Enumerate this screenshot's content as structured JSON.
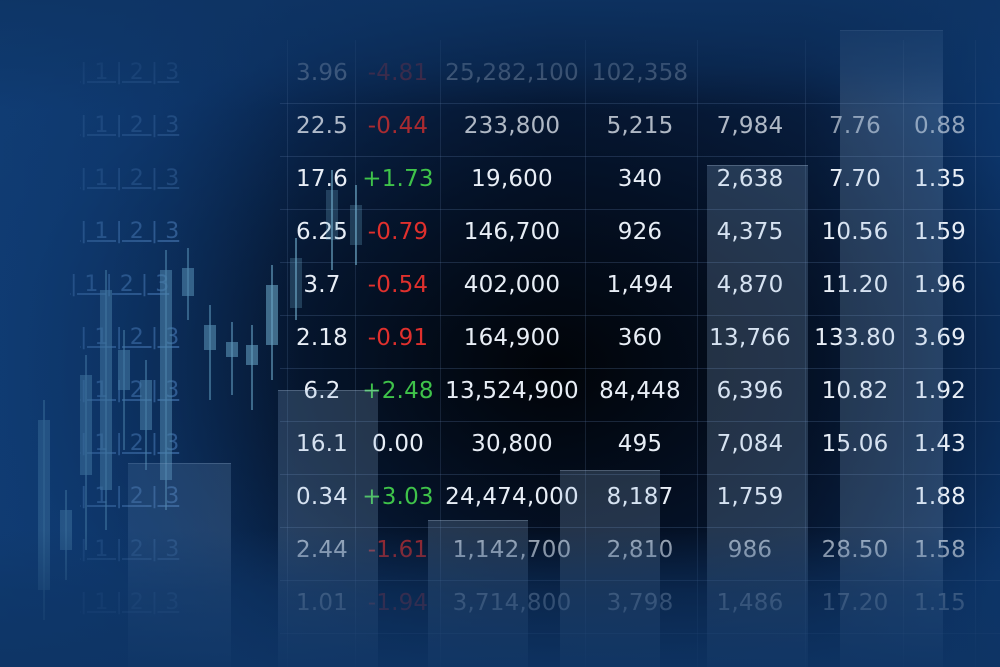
{
  "side_labels": [
    "| 1 | 2 | 3",
    "| 1 | 2 | 3",
    "| 1 | 2 | 3",
    "| 1 | 2 | 3",
    "| 1 | 2 | 3",
    "| 1 | 2 | 3",
    "| 1 | 2 | 3",
    "| 1 | 2 | 3",
    "| 1 | 2 | 3",
    "| 1 | 2 | 3",
    "| 1 | 2 | 3"
  ],
  "rows": [
    {
      "c1": "3.96",
      "c2": "-4.81",
      "c2_sign": "neg",
      "c3": "25,282,100",
      "c4": "102,358",
      "c5": "",
      "c6": "",
      "c7": ""
    },
    {
      "c1": "22.5",
      "c2": "-0.44",
      "c2_sign": "neg",
      "c3": "233,800",
      "c4": "5,215",
      "c5": "7,984",
      "c6": "7.76",
      "c7": "0.88"
    },
    {
      "c1": "17.6",
      "c2": "+1.73",
      "c2_sign": "pos",
      "c3": "19,600",
      "c4": "340",
      "c5": "2,638",
      "c6": "7.70",
      "c7": "1.35"
    },
    {
      "c1": "6.25",
      "c2": "-0.79",
      "c2_sign": "neg",
      "c3": "146,700",
      "c4": "926",
      "c5": "4,375",
      "c6": "10.56",
      "c7": "1.59"
    },
    {
      "c1": "3.7",
      "c2": "-0.54",
      "c2_sign": "neg",
      "c3": "402,000",
      "c4": "1,494",
      "c5": "4,870",
      "c6": "11.20",
      "c7": "1.96"
    },
    {
      "c1": "2.18",
      "c2": "-0.91",
      "c2_sign": "neg",
      "c3": "164,900",
      "c4": "360",
      "c5": "13,766",
      "c6": "133.80",
      "c7": "3.69"
    },
    {
      "c1": "6.2",
      "c2": "+2.48",
      "c2_sign": "pos",
      "c3": "13,524,900",
      "c4": "84,448",
      "c5": "6,396",
      "c6": "10.82",
      "c7": "1.92"
    },
    {
      "c1": "16.1",
      "c2": "0.00",
      "c2_sign": "neu",
      "c3": "30,800",
      "c4": "495",
      "c5": "7,084",
      "c6": "15.06",
      "c7": "1.43"
    },
    {
      "c1": "0.34",
      "c2": "+3.03",
      "c2_sign": "pos",
      "c3": "24,474,000",
      "c4": "8,187",
      "c5": "1,759",
      "c6": "",
      "c7": "1.88"
    },
    {
      "c1": "2.44",
      "c2": "-1.61",
      "c2_sign": "neg",
      "c3": "1,142,700",
      "c4": "2,810",
      "c5": "986",
      "c6": "28.50",
      "c7": "1.58"
    },
    {
      "c1": "1.01",
      "c2": "-1.94",
      "c2_sign": "neg",
      "c3": "3,714,800",
      "c4": "3,798",
      "c5": "1,486",
      "c6": "17.20",
      "c7": "1.15"
    }
  ]
}
